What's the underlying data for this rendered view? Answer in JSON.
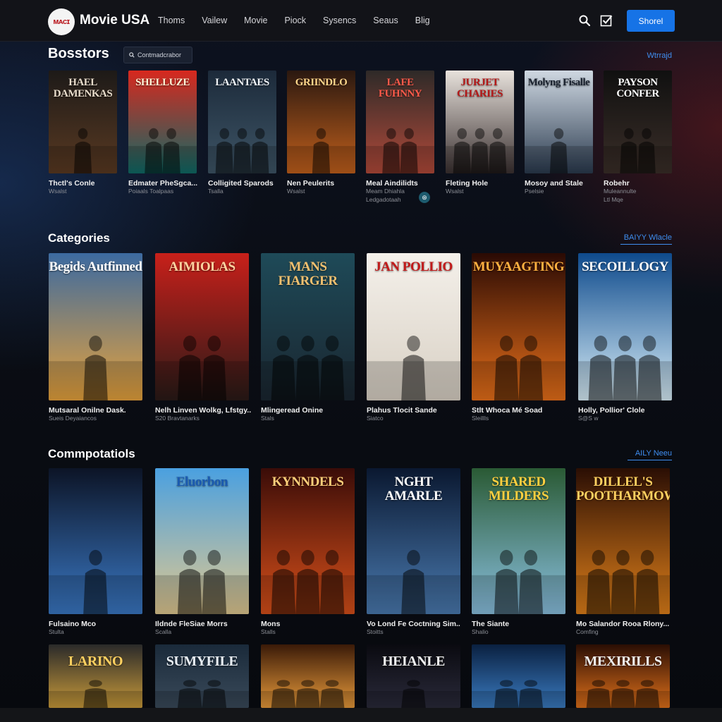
{
  "app": {
    "brand": "Movie USA",
    "logo_text": "ᴍᴀᴄɪ",
    "nav": [
      "Thoms",
      "Vailew",
      "Movie",
      "Piock",
      "Sysencs",
      "Seaus",
      "Blig"
    ],
    "share_label": "Shorel",
    "icons": [
      "search-icon",
      "check-icon"
    ]
  },
  "sections": [
    {
      "title": "Bosstors",
      "search_placeholder": "Contmadcrabor",
      "see_all": "Wtrrajd",
      "cards": [
        {
          "poster_title": "HAEL DAMENKAS",
          "title": "Thctl's Conle",
          "sub": "Wsalst",
          "sub2": "",
          "colors": [
            "#1d1a18",
            "#5a3a22"
          ],
          "title_color": "#e8dccb"
        },
        {
          "poster_title": "SHELLUZE",
          "title": "Edmater PheSgca...",
          "sub": "Poiaals Toalpaas",
          "sub2": "",
          "colors": [
            "#d8281e",
            "#0f6a66"
          ],
          "title_color": "#fff3d6"
        },
        {
          "poster_title": "LAANTAES",
          "title": "Colligited Sparods",
          "sub": "Tsalla",
          "sub2": "",
          "colors": [
            "#1c2a3a",
            "#3e5566"
          ],
          "title_color": "#f0f4f8"
        },
        {
          "poster_title": "GRIINDLO",
          "title": "Nen Peulerits",
          "sub": "Wsalst",
          "sub2": "",
          "colors": [
            "#2a1810",
            "#c2601c"
          ],
          "title_color": "#ffd58a"
        },
        {
          "poster_title": "LAFE FUHNNY",
          "title": "Meal Aindilidts",
          "sub": "Meam Dhiahla",
          "sub2": "Ledgadotaah",
          "colors": [
            "#2e2a28",
            "#b24a3a"
          ],
          "title_color": "#ff5a4a"
        },
        {
          "poster_title": "JURJET CHARIES",
          "title": "Fleting Hole",
          "sub": "Wsalst",
          "sub2": "",
          "colors": [
            "#e8e2dc",
            "#3a3030"
          ],
          "title_color": "#b41818"
        },
        {
          "poster_title": "Molyng Fisalle",
          "title": "Mosoy and Stale",
          "sub": "Pselsie",
          "sub2": "",
          "colors": [
            "#cfd8e2",
            "#2a3a4e"
          ],
          "title_color": "#1b2330"
        },
        {
          "poster_title": "PAYSON CONFER",
          "title": "Robehr",
          "sub": "Muleannulte",
          "sub2": "Ltl Mqe",
          "colors": [
            "#101010",
            "#3a2e28"
          ],
          "title_color": "#ffffff"
        }
      ]
    },
    {
      "title": "Categories",
      "see_all": "BAIYY Wlacle",
      "cards": [
        {
          "poster_title": "Begids Autfinned",
          "title": "Mutsaral Onilne Dask.",
          "sub": "Sueis Deyaiancos",
          "colors": [
            "#3c6aa0",
            "#e6a23c"
          ],
          "title_color": "#ffffff"
        },
        {
          "poster_title": "AIMIOLAS",
          "title": "Nelh Linven Wolkg, Lfstgy..",
          "sub": "S20 Bravtanarks",
          "colors": [
            "#c8201a",
            "#2a1a18"
          ],
          "title_color": "#ffd2a0"
        },
        {
          "poster_title": "MANS FIARGER",
          "title": "Mlingeread Onine",
          "sub": "Stals",
          "colors": [
            "#1e4a58",
            "#1a2630"
          ],
          "title_color": "#f0c070"
        },
        {
          "poster_title": "JAN POLLIO",
          "title": "Plahus Tlocit Sande",
          "sub": "Siatco",
          "colors": [
            "#f4f0ea",
            "#d8d0c4"
          ],
          "title_color": "#c21a1a"
        },
        {
          "poster_title": "MUYAAGTING",
          "title": "Stlt Whoca Mé Soad",
          "sub": "Sleillls",
          "colors": [
            "#2a0a04",
            "#e8701a"
          ],
          "title_color": "#ffb040"
        },
        {
          "poster_title": "SECOILLOGY",
          "title": "Holly, Pollior' Clole",
          "sub": "S@S w",
          "colors": [
            "#0e4a8c",
            "#d8eef8"
          ],
          "title_color": "#ffffff"
        }
      ]
    },
    {
      "title": "Commpotatiols",
      "see_all": "AILY Neeu",
      "cards": [
        {
          "poster_title": "",
          "title": "Fulsaino Mco",
          "sub": "Stulta",
          "colors": [
            "#0c1426",
            "#3a78c4"
          ],
          "title_color": "#ffffff"
        },
        {
          "poster_title": "Eluorbon",
          "title": "Ildnde FleSiae Morrs",
          "sub": "Scalla",
          "colors": [
            "#4aa0e0",
            "#e0c890"
          ],
          "title_color": "#1a5ab0"
        },
        {
          "poster_title": "KYNNDELS",
          "title": "Mons",
          "sub": "Stalls",
          "colors": [
            "#3a0c08",
            "#d8501a"
          ],
          "title_color": "#ffcf7a"
        },
        {
          "poster_title": "NGHT AMARLE",
          "title": "Vo Lond Fe Coctning Sim..",
          "sub": "Stoitts",
          "colors": [
            "#0a1830",
            "#4a7ab0"
          ],
          "title_color": "#ffffff"
        },
        {
          "poster_title": "SHARED MILDERS",
          "title": "The Siante",
          "sub": "Shalio",
          "colors": [
            "#2a5a34",
            "#8ac0e0"
          ],
          "title_color": "#ffd040"
        },
        {
          "poster_title": "DILLEL'S POOTHARMOW",
          "title": "Mo Salandor Rooa Rlony...",
          "sub": "Comfing",
          "colors": [
            "#2a0e04",
            "#e0801a"
          ],
          "title_color": "#ffd060"
        }
      ]
    },
    {
      "title": "",
      "see_all": "",
      "cards": [
        {
          "poster_title": "LARINO",
          "colors": [
            "#2a2a2a",
            "#c89a3a"
          ],
          "title_color": "#ffd060"
        },
        {
          "poster_title": "SUMYFILE",
          "colors": [
            "#1a2a3a",
            "#3a4a5a"
          ],
          "title_color": "#e8eef4"
        },
        {
          "poster_title": "",
          "colors": [
            "#3a1a08",
            "#e89a3a"
          ],
          "title_color": "#ffffff"
        },
        {
          "poster_title": "HEIANLE",
          "colors": [
            "#0a0a10",
            "#2a2a3a"
          ],
          "title_color": "#f0f0f0"
        },
        {
          "poster_title": "",
          "colors": [
            "#0a2040",
            "#3a7ac0"
          ],
          "title_color": "#ffffff"
        },
        {
          "poster_title": "MEXIRILLS",
          "colors": [
            "#2a0e04",
            "#e0701a"
          ],
          "title_color": "#f0f0f0"
        }
      ]
    }
  ]
}
